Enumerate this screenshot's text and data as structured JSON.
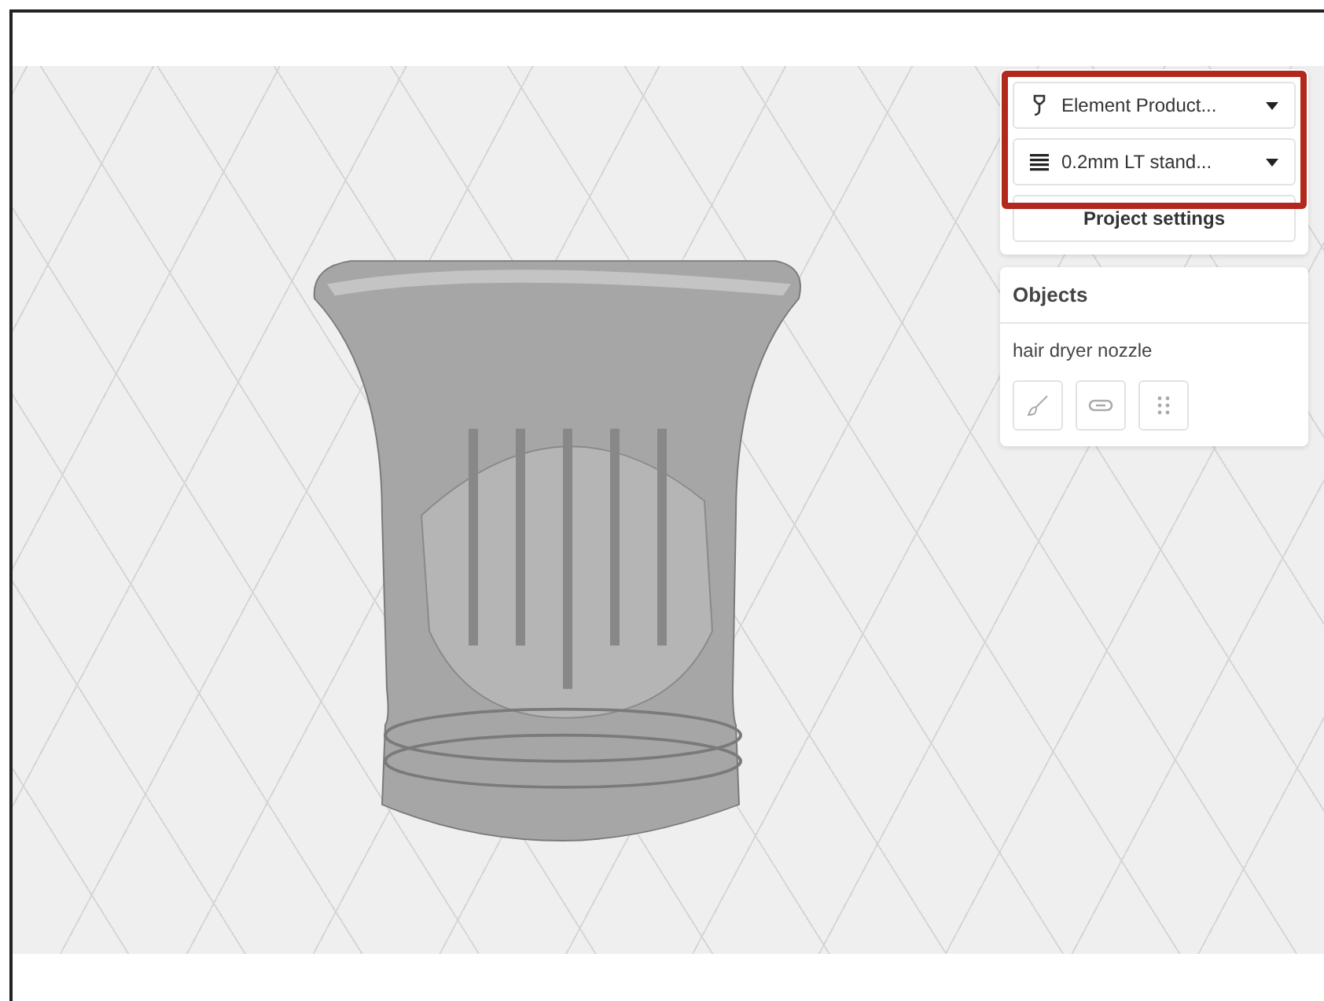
{
  "print_settings": {
    "printer": {
      "label": "Element Product..."
    },
    "profile": {
      "label": "0.2mm LT stand..."
    },
    "project_button": "Project settings"
  },
  "objects_panel": {
    "title": "Objects",
    "items": [
      {
        "name": "hair dryer nozzle"
      }
    ]
  }
}
